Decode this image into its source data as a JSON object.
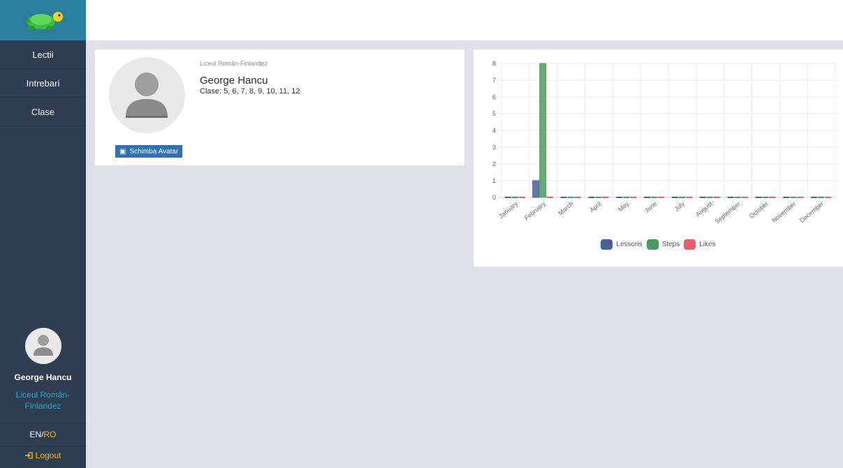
{
  "sidebar": {
    "nav": [
      "Lectii",
      "Intrebari",
      "Clase"
    ],
    "user_name": "George Hancu",
    "school": "Liceul Român-Finlandez",
    "lang_en": "EN",
    "lang_sep": "/",
    "lang_ro": "RO",
    "logout_icon": "sign-in-icon",
    "logout": "Logout"
  },
  "profile": {
    "school": "Liceul Român-Finlandez",
    "name": "George Hancu",
    "classes_label": "Clase:",
    "classes": "5, 6, 7, 8, 9, 10, 11, 12",
    "avatar_button": "Schimba Avatar",
    "avatar_button_icon": "image-icon"
  },
  "colors": {
    "sidebar_bg": "#2e3e50",
    "logo_bg": "#2a7f9f",
    "accent_yellow": "#f5b819",
    "accent_teal": "#2aa6c8",
    "button_blue": "#2f71b1",
    "lessons": "#4a5f9a",
    "steps": "#4e9a5e",
    "likes": "#f05a6c"
  },
  "chart_data": {
    "type": "bar",
    "categories": [
      "January",
      "February",
      "March",
      "April",
      "May",
      "June",
      "July",
      "August",
      "September",
      "October",
      "November",
      "December"
    ],
    "series": [
      {
        "name": "Lessons",
        "values": [
          0,
          1,
          0,
          0,
          0,
          0,
          0,
          0,
          0,
          0,
          0,
          0
        ]
      },
      {
        "name": "Steps",
        "values": [
          0,
          8,
          0,
          0,
          0,
          0,
          0,
          0,
          0,
          0,
          0,
          0
        ]
      },
      {
        "name": "Likes",
        "values": [
          0,
          0,
          0,
          0,
          0,
          0,
          0,
          0,
          0,
          0,
          0,
          0
        ]
      }
    ],
    "ylim": [
      0,
      8
    ],
    "yticks": [
      0,
      1,
      2,
      3,
      4,
      5,
      6,
      7,
      8
    ],
    "grid": true,
    "legend": "bottom"
  }
}
